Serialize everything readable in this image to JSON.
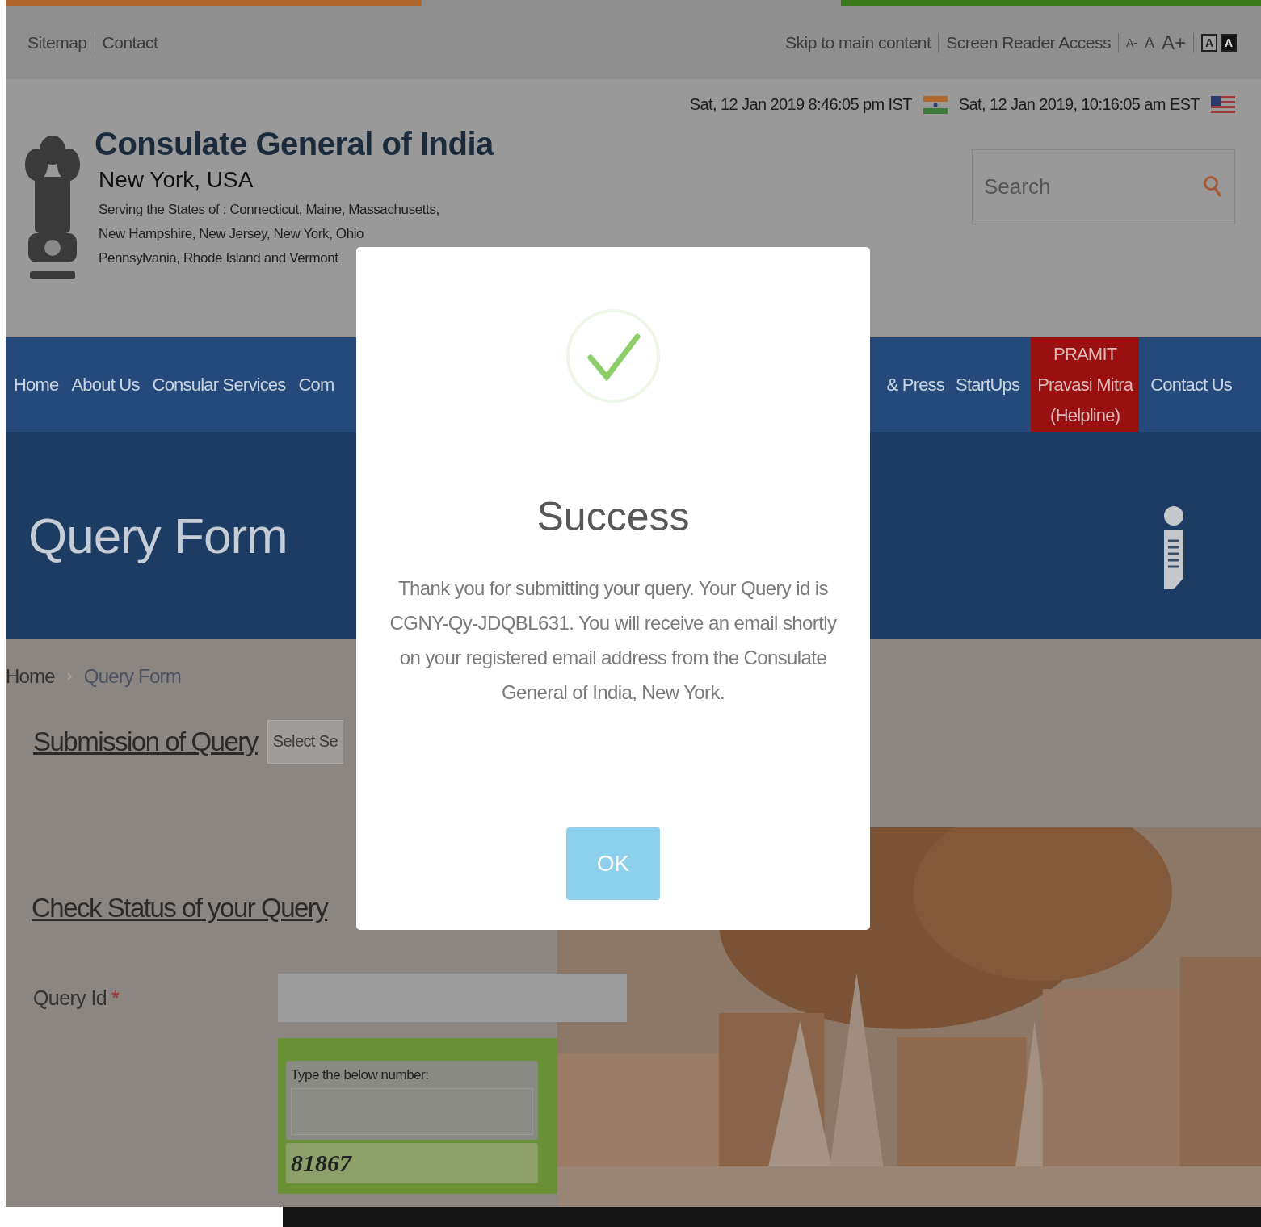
{
  "top_bar": {
    "left_links": [
      "Sitemap",
      "Contact"
    ],
    "skip_link": "Skip to main content",
    "screen_reader_link": "Screen Reader Access",
    "font_sizes": [
      "A-",
      "A",
      "A+"
    ],
    "contrast": [
      {
        "label": "A",
        "kind": "light"
      },
      {
        "label": "A",
        "kind": "dark"
      }
    ]
  },
  "header": {
    "title": "Consulate General of India",
    "city": "New York, USA",
    "serving_lines": [
      "Serving the States of : Connecticut, Maine, Massachusetts,",
      "New Hampshire, New Jersey, New York, Ohio",
      "Pennsylvania, Rhode Island and Vermont"
    ],
    "clocks": [
      {
        "time": "Sat, 12 Jan 2019 8:46:05 pm IST",
        "kind": "india"
      },
      {
        "time": "Sat, 12 Jan 2019, 10:16:05 am EST",
        "kind": "usa"
      }
    ],
    "search": {
      "placeholder": "Search"
    }
  },
  "nav": {
    "items": [
      {
        "label": "Home",
        "highlighted": false
      },
      {
        "label": "About Us",
        "highlighted": false
      },
      {
        "label": "Consular Services",
        "highlighted": false
      },
      {
        "label": "Com",
        "highlighted": false
      }
    ],
    "items_right": [
      {
        "label": "& Press",
        "highlighted": false
      },
      {
        "label": "StartUps",
        "highlighted": false
      },
      {
        "label": "PRAMIT\nPravasi Mitra\n(Helpline)",
        "highlighted": true
      },
      {
        "label": "Contact Us",
        "highlighted": false
      }
    ]
  },
  "banner": {
    "title": "Query Form"
  },
  "breadcrumb": [
    "Home",
    "Query Form"
  ],
  "submission": {
    "heading": "Submission of Query",
    "select_value": "Select Se"
  },
  "check_status": {
    "heading": "Check Status of your Query",
    "query_id_label": "Query Id",
    "required_mark": "*",
    "captcha_label": "Type the below number:",
    "captcha_code": "81867"
  },
  "dialog": {
    "title": "Success",
    "message": "Thank you for submitting your query. Your Query id is CGNY-Qy-JDQBL631. You will receive an email shortly on your registered email address from the Consulate General of India, New York.",
    "button": "OK"
  }
}
